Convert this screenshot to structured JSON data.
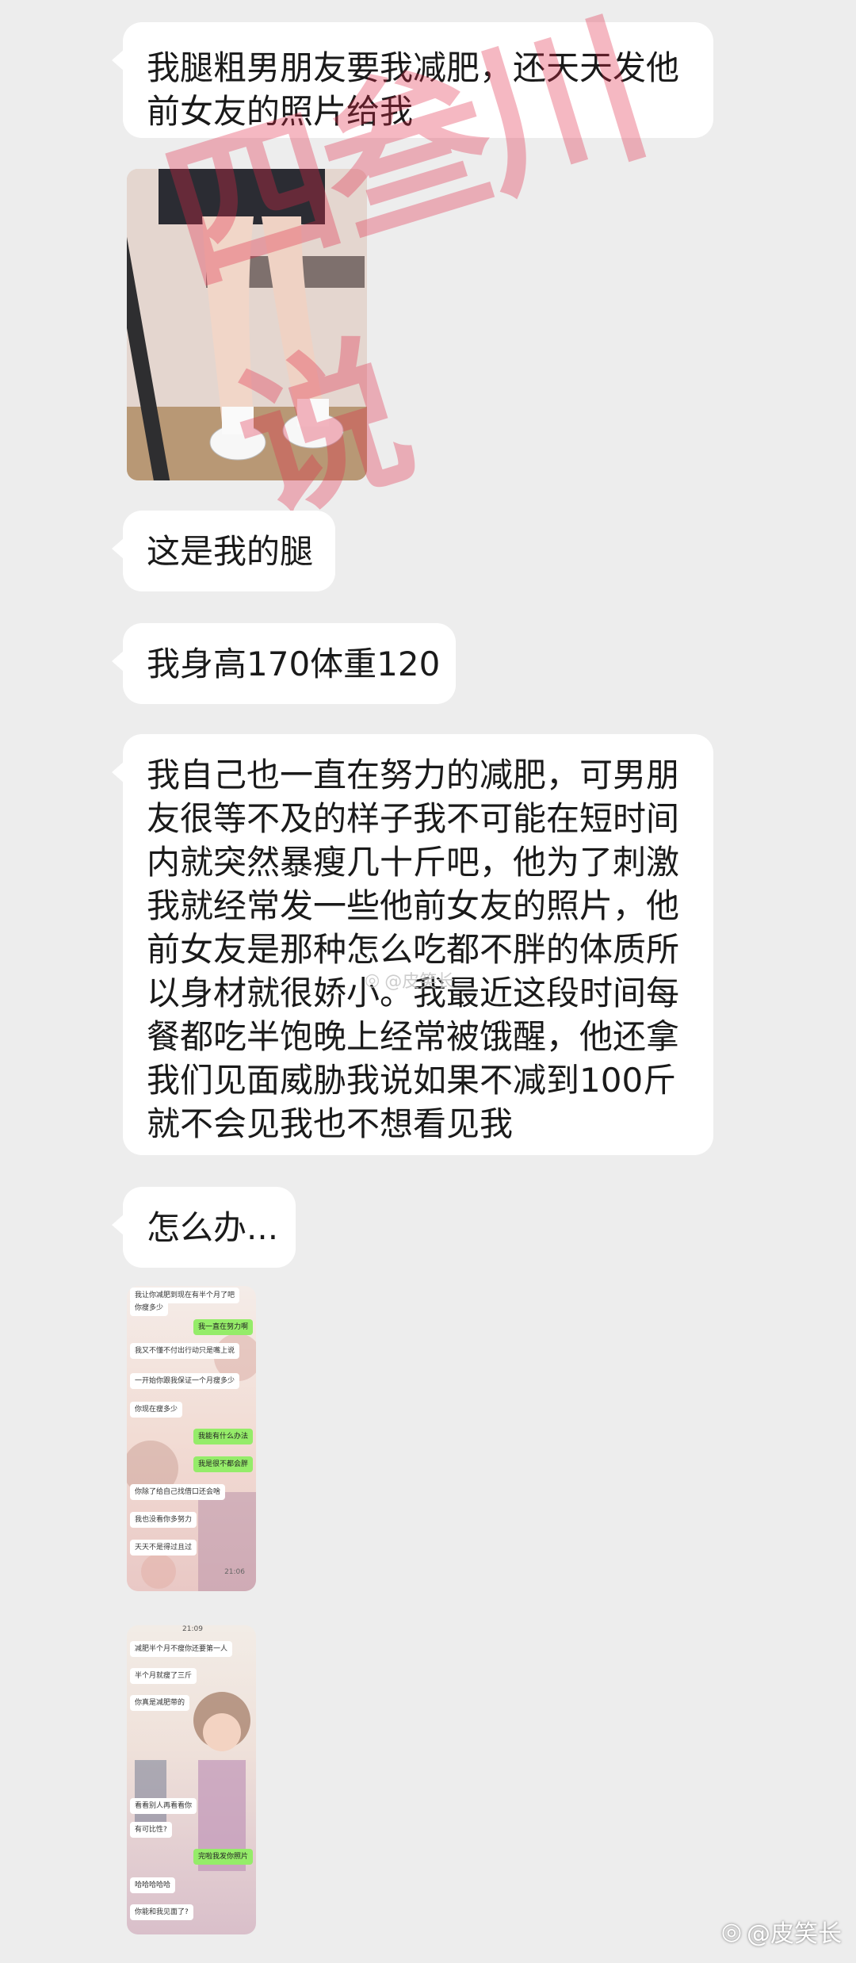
{
  "messages": {
    "m1": [
      "我腿粗男朋友要我减肥，还天天发他",
      "前女友的照片给我"
    ],
    "m2": "这是我的腿",
    "m3": "我身高170体重120",
    "m4": [
      "我自己也一直在努力的减肥，可男朋",
      "友很等不及的样子我不可能在短时间",
      "内就突然暴瘦几十斤吧，他为了刺激",
      "我就经常发一些他前女友的照片，他",
      "前女友是那种怎么吃都不胖的体质所",
      "以身材就很娇小。我最近这段时间每",
      "餐都吃半饱晚上经常被饿醒，他还拿",
      "我们见面威胁我说如果不减到100斤",
      "就不会见我也不想看见我"
    ],
    "m5": "怎么办..."
  },
  "watermark": "四叁川说",
  "screenshot1": {
    "msgs": [
      {
        "text": "我让你减肥到现在有半个月了吧",
        "side": "w"
      },
      {
        "text": "你瘦多少",
        "side": "w"
      },
      {
        "text": "我一直在努力啊",
        "side": "g"
      },
      {
        "text": "我又不懂不付出行动只是嘴上说",
        "side": "w"
      },
      {
        "text": "一开始你跟我保证一个月瘦多少",
        "side": "w"
      },
      {
        "text": "你现在瘦多少",
        "side": "w"
      },
      {
        "text": "我能有什么办法",
        "side": "g"
      },
      {
        "text": "我是很不都会胖",
        "side": "g"
      },
      {
        "text": "你除了给自己找借口还会啥",
        "side": "w"
      },
      {
        "text": "我也没看你多努力",
        "side": "w"
      },
      {
        "text": "天天不是得过且过",
        "side": "w"
      }
    ],
    "time": "21:06"
  },
  "screenshot2": {
    "time": "21:09",
    "msgs": [
      {
        "text": "减肥半个月不瘦你还要第一人",
        "side": "w"
      },
      {
        "text": "半个月就瘦了三斤",
        "side": "w"
      },
      {
        "text": "你真是减肥带的",
        "side": "w"
      },
      {
        "text": "看看别人再看看你",
        "side": "w"
      },
      {
        "text": "有可比性?",
        "side": "w"
      },
      {
        "text": "完啦我发你照片",
        "side": "g"
      },
      {
        "text": "哈哈哈哈哈",
        "side": "w"
      },
      {
        "text": "你能和我见面了?",
        "side": "w"
      }
    ]
  },
  "footer": {
    "weibo_tag": "@皮笑长"
  },
  "center_tag": "@皮笑长",
  "colors": {
    "background": "#ededed",
    "bubble": "#ffffff",
    "watermark": "#e12846",
    "green": "#95ec69"
  }
}
